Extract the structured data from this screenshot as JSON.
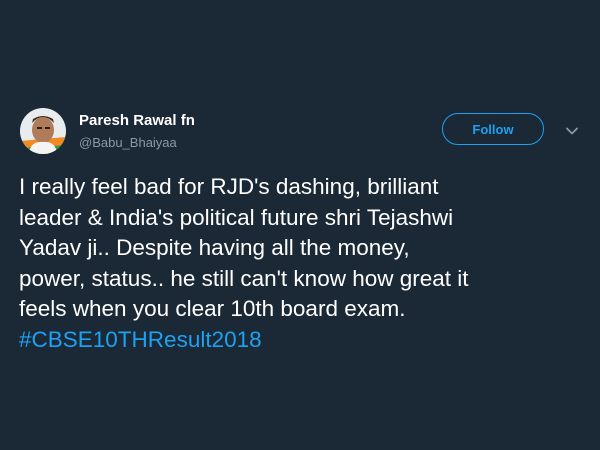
{
  "tweet": {
    "author": {
      "display_name": "Paresh Rawal fn",
      "handle": "@Babu_Bhaiyaa",
      "avatar_icon": "profile-photo"
    },
    "follow_label": "Follow",
    "more_icon": "chevron-down-icon",
    "text_lines": [
      "I really feel bad for RJD's dashing, brilliant",
      "leader & India's political future shri Tejashwi",
      "Yadav ji.. Despite having all the money,",
      "power, status.. he still can't know how great it",
      "feels when you clear 10th board exam."
    ],
    "hashtag": "#CBSE10THResult2018"
  },
  "colors": {
    "background": "#1b2836",
    "accent": "#1da1f2",
    "secondary_text": "#8899a6",
    "primary_text": "#ffffff"
  }
}
